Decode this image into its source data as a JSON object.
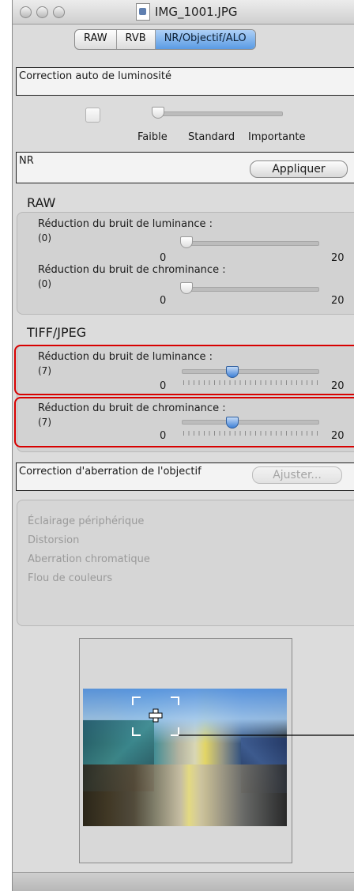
{
  "window": {
    "title": "IMG_1001.JPG"
  },
  "tabs": [
    {
      "label": "RAW",
      "active": false
    },
    {
      "label": "RVB",
      "active": false
    },
    {
      "label": "NR/Objectif/ALO",
      "active": true
    }
  ],
  "alo": {
    "header": "Correction auto de luminosité",
    "checked": false,
    "levels": [
      "Faible",
      "Standard",
      "Importante"
    ]
  },
  "nr": {
    "header": "NR",
    "apply_label": "Appliquer",
    "raw": {
      "title": "RAW",
      "luminance": {
        "label": "Réduction du bruit de luminance :",
        "value": "(0)",
        "min": "0",
        "max": "20"
      },
      "chrominance": {
        "label": "Réduction du bruit de chrominance :",
        "value": "(0)",
        "min": "0",
        "max": "20"
      }
    },
    "tiff_jpeg": {
      "title": "TIFF/JPEG",
      "luminance": {
        "label": "Réduction du bruit de luminance :",
        "value": "(7)",
        "min": "0",
        "max": "20"
      },
      "chrominance": {
        "label": "Réduction du bruit de chrominance :",
        "value": "(7)",
        "min": "0",
        "max": "20"
      }
    }
  },
  "lens": {
    "header": "Correction d'aberration de l'objectif",
    "adjust_label": "Ajuster...",
    "options": [
      "Éclairage périphérique",
      "Distorsion",
      "Aberration chromatique",
      "Flou de couleurs"
    ]
  },
  "colors": {
    "highlight": "#d80000",
    "active_tab": "#5a9be4",
    "slider_blue": "#3e80d6"
  }
}
